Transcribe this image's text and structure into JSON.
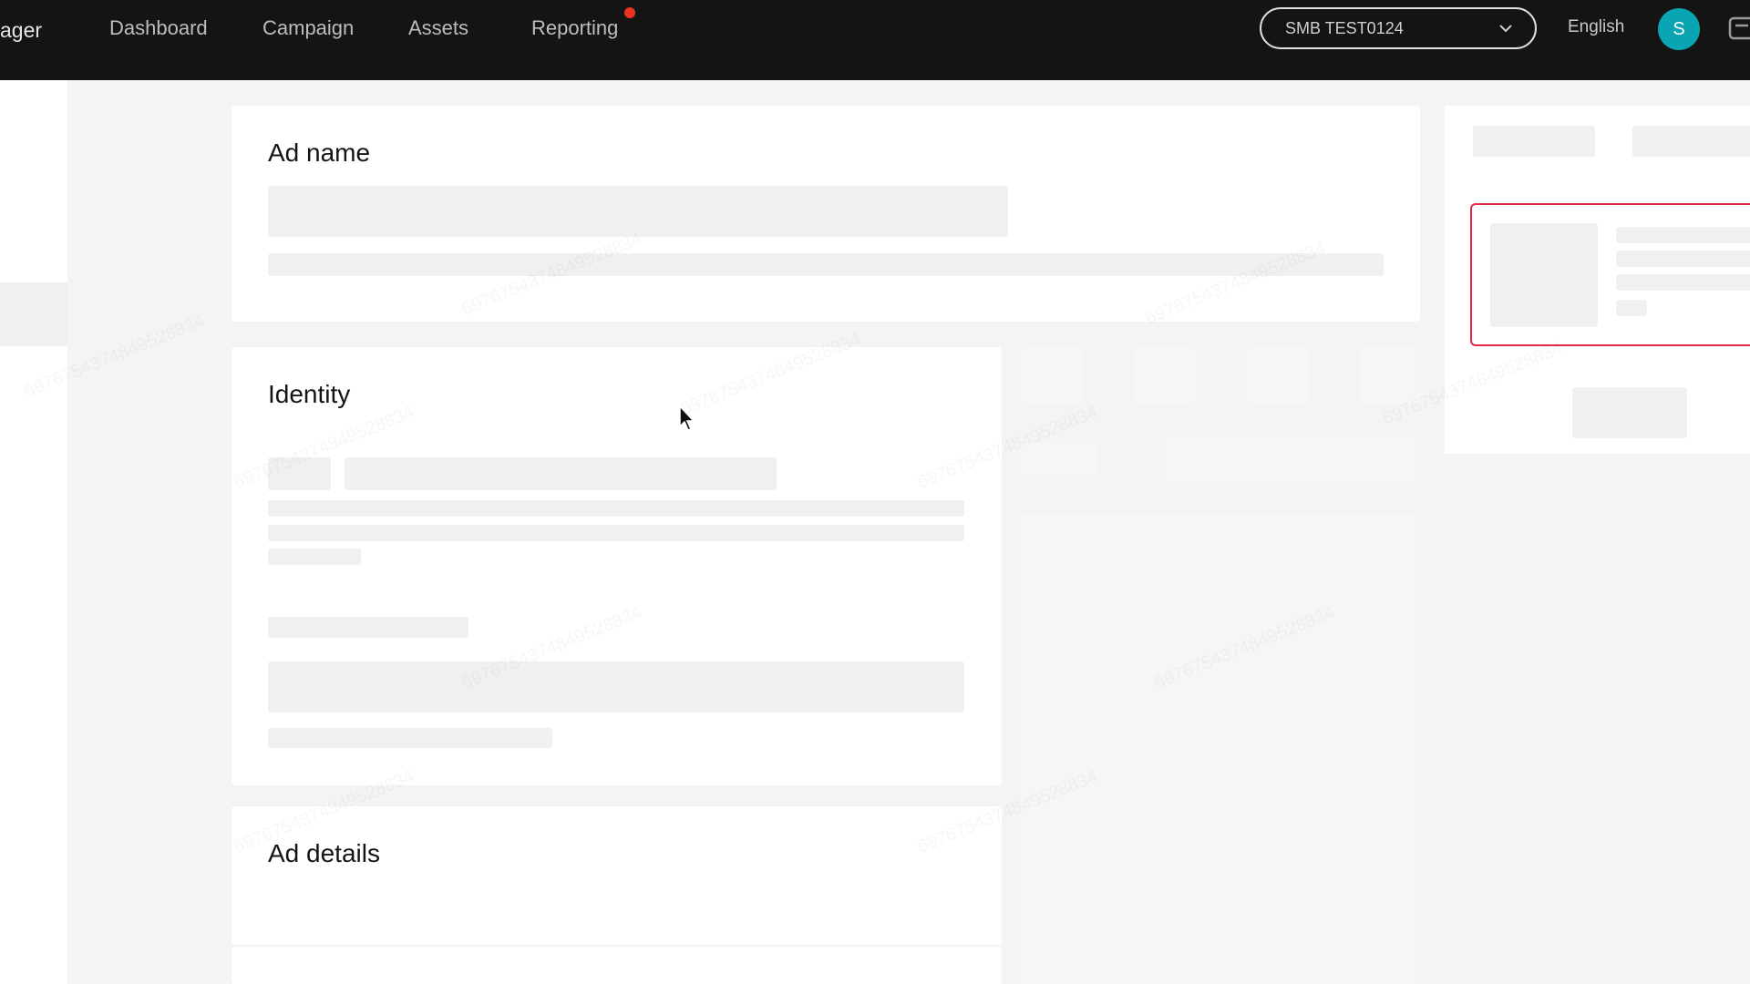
{
  "brand": "ager",
  "nav": [
    {
      "label": "Dashboard"
    },
    {
      "label": "Campaign"
    },
    {
      "label": "Assets"
    },
    {
      "label": "Reporting"
    }
  ],
  "account_selector": {
    "value": "SMB TEST0124"
  },
  "language": "English",
  "avatar_initial": "S",
  "sections": {
    "ad_name": "Ad name",
    "identity": "Identity",
    "ad_details": "Ad details"
  },
  "colors": {
    "topbar": "#141414",
    "avatar": "#0aa5b3",
    "notification_dot": "#ea3323",
    "preview_highlight": "#e0294c"
  }
}
